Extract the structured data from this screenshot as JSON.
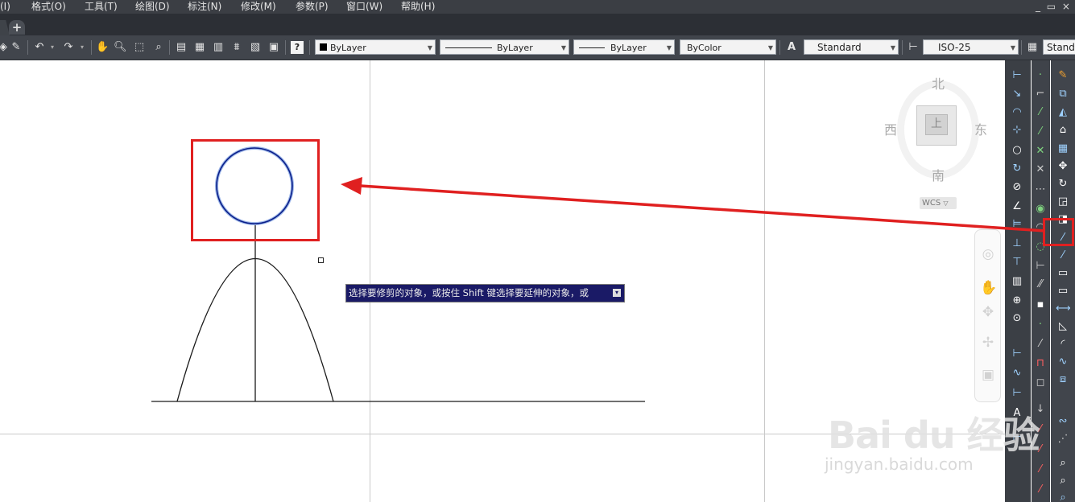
{
  "menu": {
    "items": [
      "(I)",
      "格式(O)",
      "工具(T)",
      "绘图(D)",
      "标注(N)",
      "修改(M)",
      "参数(P)",
      "窗口(W)",
      "帮助(H)"
    ],
    "window_controls": "_ ▭ ×"
  },
  "tabs": {
    "new_tab": "+"
  },
  "toolbar": {
    "color_dropdown": "ByLayer",
    "linetype_dropdown": "ByLayer",
    "lineweight_dropdown": "ByLayer",
    "plotstyle_dropdown": "ByColor",
    "text_style_dropdown": "Standard",
    "dim_style_dropdown": "ISO-25",
    "table_style_dropdown": "Standa",
    "colors": {
      "bg": "#41454c",
      "dropdown_bg": "#f3f3f3"
    }
  },
  "viewcube": {
    "north": "北",
    "south": "南",
    "east": "东",
    "west": "西",
    "face": "上",
    "wcs": "WCS"
  },
  "tooltip": {
    "text": "选择要修剪的对象，或按住 Shift 键选择要延伸的对象，或"
  },
  "drawing": {
    "stroke_color": "#1a1a1a",
    "circle_color": "#0b1f8a",
    "annotation_color": "#e02020"
  },
  "watermark": {
    "logo": "Bai du 经验",
    "url": "jingyan.baidu.com"
  }
}
